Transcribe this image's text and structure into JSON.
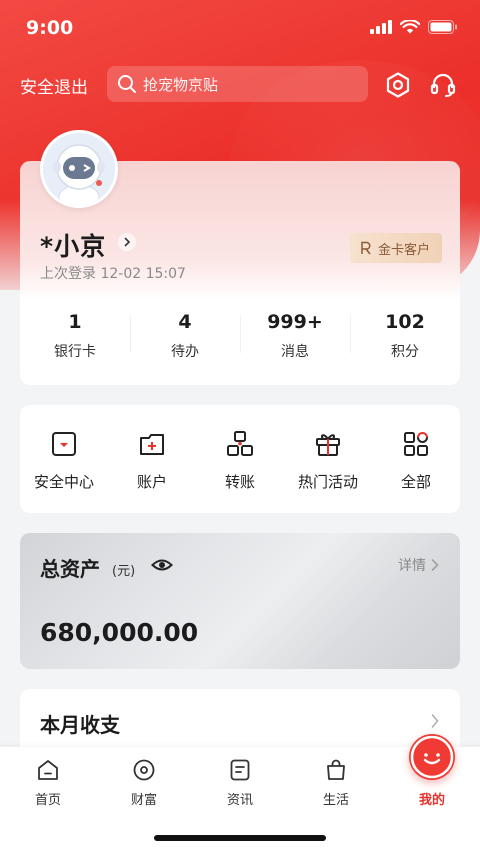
{
  "status_bar": {
    "time": "9:00"
  },
  "header": {
    "logout_label": "安全退出",
    "search_placeholder": "抢宠物京贴"
  },
  "profile": {
    "username": "*小京",
    "last_login": "上次登录 12-02 15:07",
    "badge_label": "金卡客户",
    "stats": [
      {
        "value": "1",
        "label": "银行卡"
      },
      {
        "value": "4",
        "label": "待办"
      },
      {
        "value": "999+",
        "label": "消息"
      },
      {
        "value": "102",
        "label": "积分"
      }
    ]
  },
  "quick_actions": [
    {
      "label": "安全中心",
      "icon": "security-center-icon"
    },
    {
      "label": "账户",
      "icon": "account-icon"
    },
    {
      "label": "转账",
      "icon": "transfer-icon"
    },
    {
      "label": "热门活动",
      "icon": "gift-icon"
    },
    {
      "label": "全部",
      "icon": "all-apps-icon"
    }
  ],
  "assets": {
    "title": "总资产",
    "unit": "(元)",
    "detail_label": "详情",
    "amount": "680,000.00"
  },
  "monthly": {
    "title": "本月收支"
  },
  "tab_bar": {
    "tabs": [
      {
        "label": "首页",
        "icon": "home-icon"
      },
      {
        "label": "财富",
        "icon": "wealth-icon"
      },
      {
        "label": "资讯",
        "icon": "news-icon"
      },
      {
        "label": "生活",
        "icon": "shopping-bag-icon"
      },
      {
        "label": "我的",
        "icon": "mine-icon",
        "active": true
      }
    ]
  },
  "colors": {
    "brand_red": "#e8322d",
    "gold_text": "#8a5a36"
  }
}
